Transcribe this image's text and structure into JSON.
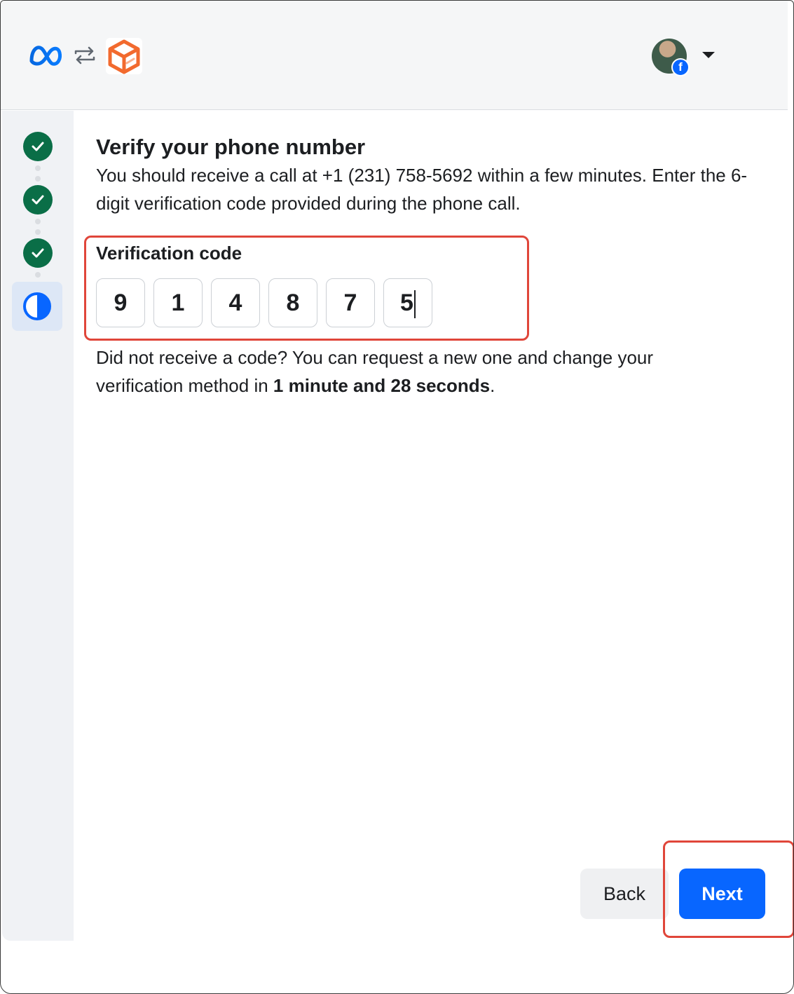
{
  "header": {
    "meta_logo_icon": "meta-infinity-icon",
    "swap_icon": "swap-arrows-icon",
    "app_icon": "orange-cube-app-icon",
    "avatar_badge": "f",
    "account_menu_icon": "caret-down-icon"
  },
  "steps": [
    {
      "state": "complete",
      "icon": "check-icon"
    },
    {
      "state": "complete",
      "icon": "check-icon"
    },
    {
      "state": "complete",
      "icon": "check-icon"
    },
    {
      "state": "current",
      "icon": "half-circle-icon"
    }
  ],
  "main": {
    "title": "Verify your phone number",
    "description": "You should receive a call at +1 (231) 758-5692 within a few minutes. Enter the 6-digit verification code provided during the phone call.",
    "code_label": "Verification code",
    "code_digits": [
      "9",
      "1",
      "4",
      "8",
      "7",
      "5"
    ],
    "resend_text_prefix": "Did not receive a code? You can request a new one and change your verification method in ",
    "resend_time": "1 minute and 28 seconds",
    "resend_text_suffix": "."
  },
  "footer": {
    "back_label": "Back",
    "next_label": "Next"
  },
  "colors": {
    "primary": "#0866ff",
    "step_complete": "#0a6e47",
    "highlight": "#e0463a"
  }
}
